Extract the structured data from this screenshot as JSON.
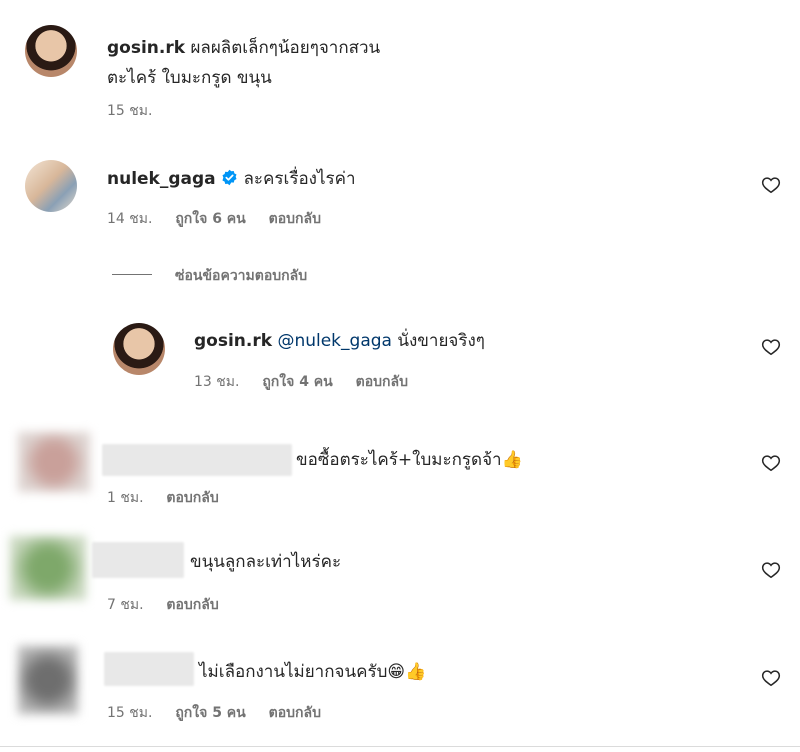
{
  "comments": [
    {
      "username": "gosin.rk",
      "text_line1": "ผลผลิตเล็กๆน้อยๆจากสวน",
      "text_line2": "ตะไคร้ ใบมะกรูด ขนุน",
      "time": "15 ชม."
    },
    {
      "username": "nulek_gaga",
      "text": "ละครเรื่องไรค่า",
      "time": "14 ชม.",
      "likes": "ถูกใจ 6 คน",
      "reply_label": "ตอบกลับ"
    },
    {
      "username": "",
      "text": "ขอซื้อตระไคร้+ใบมะกรูดจ้า👍",
      "time": "1 ชม.",
      "reply_label": "ตอบกลับ"
    },
    {
      "username": "",
      "text": "ขนุนลูกละเท่าไหร่คะ",
      "time": "7 ชม.",
      "reply_label": "ตอบกลับ"
    },
    {
      "username": "",
      "text": "ไม่เลือกงานไม่ยากจนครับ😁👍",
      "time": "15 ชม.",
      "likes": "ถูกใจ 5 คน",
      "reply_label": "ตอบกลับ"
    }
  ],
  "hide_replies_label": "ซ่อนข้อความตอบกลับ",
  "reply": {
    "username": "gosin.rk",
    "mention": "@nulek_gaga",
    "text": "นั่งขายจริงๆ",
    "time": "13 ชม.",
    "likes": "ถูกใจ 4 คน",
    "reply_label": "ตอบกลับ"
  },
  "colors": {
    "text": "#262626",
    "meta": "#737373",
    "verified": "#0095f6",
    "mention": "#00376b"
  },
  "icons": [
    "heart-icon",
    "verified-badge-icon"
  ]
}
